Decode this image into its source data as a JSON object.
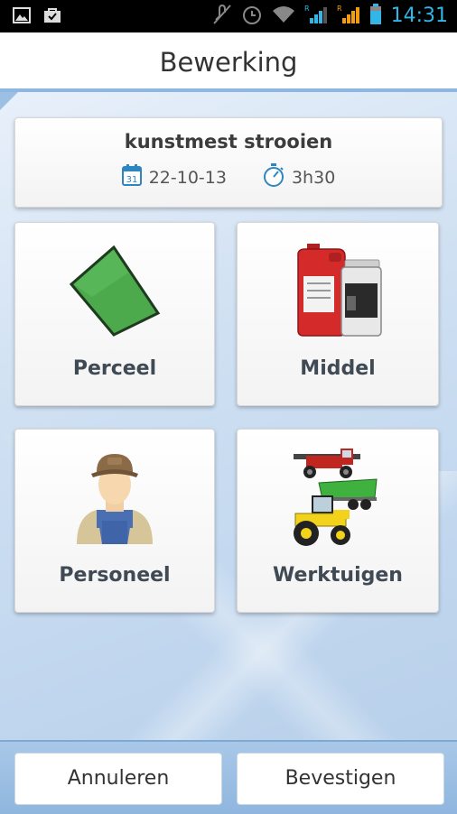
{
  "status_bar": {
    "time": "14:31",
    "icons": [
      "gallery-icon",
      "shopping-bag-icon",
      "mute-icon",
      "alarm-icon",
      "wifi-icon",
      "signal-icon",
      "signal-icon",
      "battery-icon"
    ],
    "accent_color": "#33b5e5"
  },
  "header": {
    "title": "Bewerking"
  },
  "operation": {
    "name": "kunstmest strooien",
    "date": "22-10-13",
    "duration": "3h30",
    "date_icon": "calendar-icon",
    "duration_icon": "stopwatch-icon"
  },
  "tiles": [
    {
      "label": "Perceel",
      "icon": "field-icon"
    },
    {
      "label": "Middel",
      "icon": "product-container-icon"
    },
    {
      "label": "Personeel",
      "icon": "farmer-icon"
    },
    {
      "label": "Werktuigen",
      "icon": "machinery-icon"
    }
  ],
  "footer": {
    "cancel_label": "Annuleren",
    "confirm_label": "Bevestigen"
  }
}
